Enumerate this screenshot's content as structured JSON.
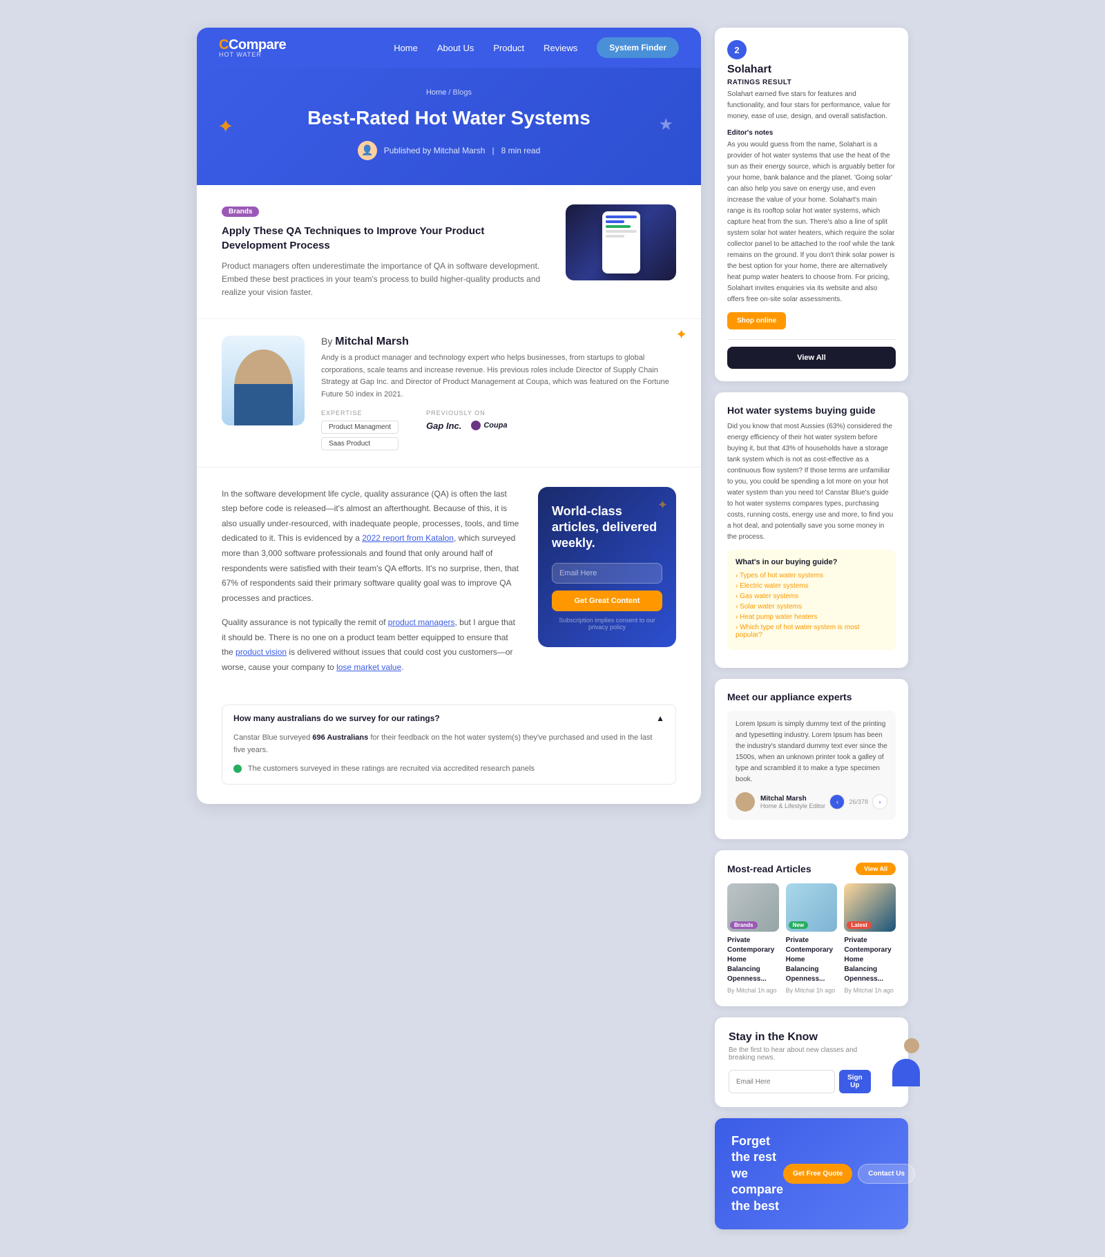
{
  "nav": {
    "logo_main": "Compare",
    "logo_sub": "Hot Water",
    "links": [
      "Home",
      "About Us",
      "Product",
      "Reviews"
    ],
    "cta": "System Finder"
  },
  "hero": {
    "breadcrumb_home": "Home",
    "breadcrumb_sep": " / ",
    "breadcrumb_page": "Blogs",
    "title": "Best-Rated Hot Water Systems",
    "published_by": "Published by Mitchal Marsh",
    "read_time": "8 min read"
  },
  "article_card": {
    "badge": "Brands",
    "title": "Apply These QA Techniques to Improve Your Product Development Process",
    "description": "Product managers often underestimate the importance of QA in software development. Embed these best practices in your team's process to build higher-quality products and realize your vision faster."
  },
  "author_bio": {
    "by_line": "By",
    "name": "Mitchal Marsh",
    "bio": "Andy is a product manager and technology expert who helps businesses, from startups to global corporations, scale teams and increase revenue. His previous roles include Director of Supply Chain Strategy at Gap Inc. and Director of Product Management at Coupa, which was featured on the Fortune Future 50 index in 2021.",
    "expertise_label": "EXPERTISE",
    "expertise_tags": [
      "Product Managment",
      "Saas Product"
    ],
    "previously_label": "Previously on",
    "previous_companies": [
      "Gap Inc.",
      "Coupa"
    ]
  },
  "article_body": {
    "paragraph1": "In the software development life cycle, quality assurance (QA) is often the last step before code is released—it's almost an afterthought. Because of this, it is also usually under-resourced, with inadequate people, processes, tools, and time dedicated to it. This is evidenced by a 2022 report from Katalon, which surveyed more than 3,000 software professionals and found that only around half of respondents were satisfied with their team's QA efforts. It's no surprise, then, that 67% of respondents said their primary software quality goal was to improve QA processes and practices.",
    "paragraph2": "Quality assurance is not typically the remit of product managers, but I argue that it should be. There is no one on a product team better equipped to ensure that the product vision is delivered without issues that could cost you customers—or worse, cause your company to lose market value.",
    "link1": "2022 report from Katalon",
    "link2": "product managers",
    "link3": "product vision",
    "link4": "lose market value"
  },
  "newsletter": {
    "heading": "World-class articles, delivered weekly.",
    "input_placeholder": "Email Here",
    "button": "Get Great Content",
    "terms": "Subscription implies consent to our privacy policy"
  },
  "faq": {
    "question1": "How many australians do we survey for our ratings?",
    "answer1_prefix": "Canstar Blue surveyed ",
    "answer1_highlight": "696 Australians",
    "answer1_suffix": " for their feedback on the hot water system(s) they've purchased and used in the last five years.",
    "bullet_text": "The customers surveyed in these ratings are recruited via accredited research panels"
  },
  "solahart": {
    "number": "2",
    "name": "Solahart",
    "ratings_label": "Ratings result",
    "ratings_text": "Solahart earned five stars for features and functionality, and four stars for performance, value for money, ease of use, design, and overall satisfaction.",
    "editors_label": "Editor's notes",
    "editors_text": "As you would guess from the name, Solahart is a provider of hot water systems that use the heat of the sun as their energy source, which is arguably better for your home, bank balance and the planet. 'Going solar' can also help you save on energy use, and even increase the value of your home. Solahart's main range is its rooftop solar hot water systems, which capture heat from the sun. There's also a line of split system solar hot water heaters, which require the solar collector panel to be attached to the roof while the tank remains on the ground. If you don't think solar power is the best option for your home, there are alternatively heat pump water heaters to choose from. For pricing, Solahart invites enquiries via its website and also offers free on-site solar assessments.",
    "shop_btn": "Shop online",
    "view_all": "View All"
  },
  "buying_guide": {
    "title": "Hot water systems buying guide",
    "intro": "Did you know that most Aussies (63%) considered the energy efficiency of their hot water system before buying it, but that 43% of households have a storage tank system which is not as cost-effective as a continuous flow system? If those terms are unfamiliar to you, you could be spending a lot more on your hot water system than you need to! Canstar Blue's guide to hot water systems compares types, purchasing costs, running costs, energy use and more, to find you a hot deal, and potentially save you some money in the process.",
    "highlight_title": "What's in our buying guide?",
    "links": [
      "Types of hot water systems",
      "Electric water systems",
      "Gas water systems",
      "Solar water systems",
      "Heat pump water heaters",
      "Which type of hot water system is most popular?"
    ]
  },
  "experts": {
    "title": "Meet our appliance experts",
    "card_text": "Lorem Ipsum is simply dummy text of the printing and typesetting industry. Lorem Ipsum has been the industry's standard dummy text ever since the 1500s, when an unknown printer took a galley of type and scrambled it to make a type specimen book.",
    "expert_name": "Mitchal Marsh",
    "expert_role": "Home & Lifestyle Editor",
    "count": "26/378"
  },
  "most_read": {
    "title": "Most-read Articles",
    "view_all": "View All",
    "articles": [
      {
        "badge": "Brands",
        "badge_type": "brands",
        "title": "Private Contemporary Home Balancing Openness...",
        "author": "By Mitchal",
        "time": "1h ago"
      },
      {
        "badge": "New",
        "badge_type": "new",
        "title": "Private Contemporary Home Balancing Openness...",
        "author": "By Mitchal",
        "time": "1h ago"
      },
      {
        "badge": "Latest",
        "badge_type": "latest",
        "title": "Private Contemporary Home Balancing Openness...",
        "author": "By Mitchal",
        "time": "1h ago"
      }
    ]
  },
  "stay": {
    "title": "Stay in the Know",
    "subtitle": "Be the first to hear about new classes and breaking news.",
    "input_placeholder": "Email Here",
    "button": "Sign Up"
  },
  "cta": {
    "line1": "Forget the rest",
    "line2": "we compare the best",
    "btn_primary": "Get Free Quote",
    "btn_secondary": "Contact Us"
  }
}
